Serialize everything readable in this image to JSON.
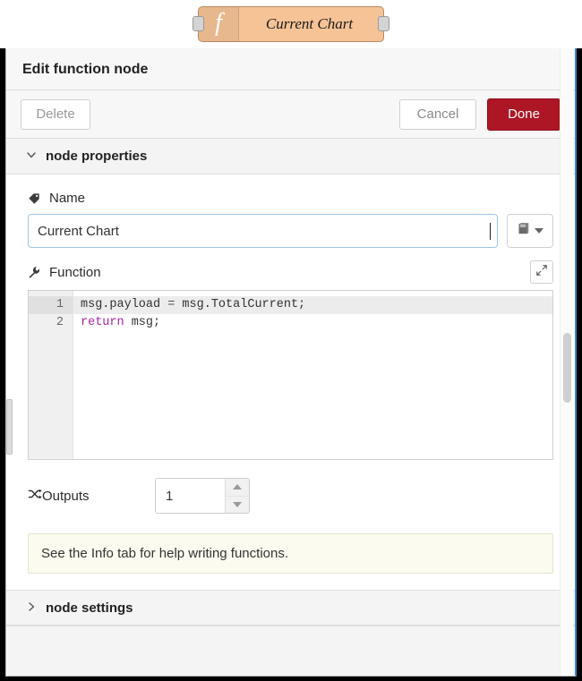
{
  "flow_node": {
    "label": "Current Chart",
    "icon": "function-f-icon",
    "background_color": "#f5c396",
    "input_port": "node-input-port",
    "output_port": "node-output-port"
  },
  "editor": {
    "title": "Edit function node",
    "toolbar": {
      "delete_label": "Delete",
      "cancel_label": "Cancel",
      "done_label": "Done",
      "done_color": "#ad1625"
    },
    "sections": {
      "properties": {
        "label": "node properties",
        "expanded": true,
        "chevron": "∨"
      },
      "settings": {
        "label": "node settings",
        "expanded": false,
        "chevron": "›"
      }
    },
    "fields": {
      "name": {
        "label": "Name",
        "icon": "tag-icon",
        "value": "Current Chart",
        "placeholder": "Name",
        "picker_button": "book-icon"
      },
      "function": {
        "label": "Function",
        "icon": "wrench-icon",
        "expand_button": "expand-icon",
        "lines": [
          {
            "number": "1",
            "active": true,
            "code": "msg.payload = msg.TotalCurrent;"
          },
          {
            "number": "2",
            "active": false,
            "code": "return msg;"
          }
        ]
      },
      "outputs": {
        "label": "Outputs",
        "icon": "shuffle-icon",
        "value": "1"
      }
    },
    "tip": "See the Info tab for help writing functions."
  }
}
